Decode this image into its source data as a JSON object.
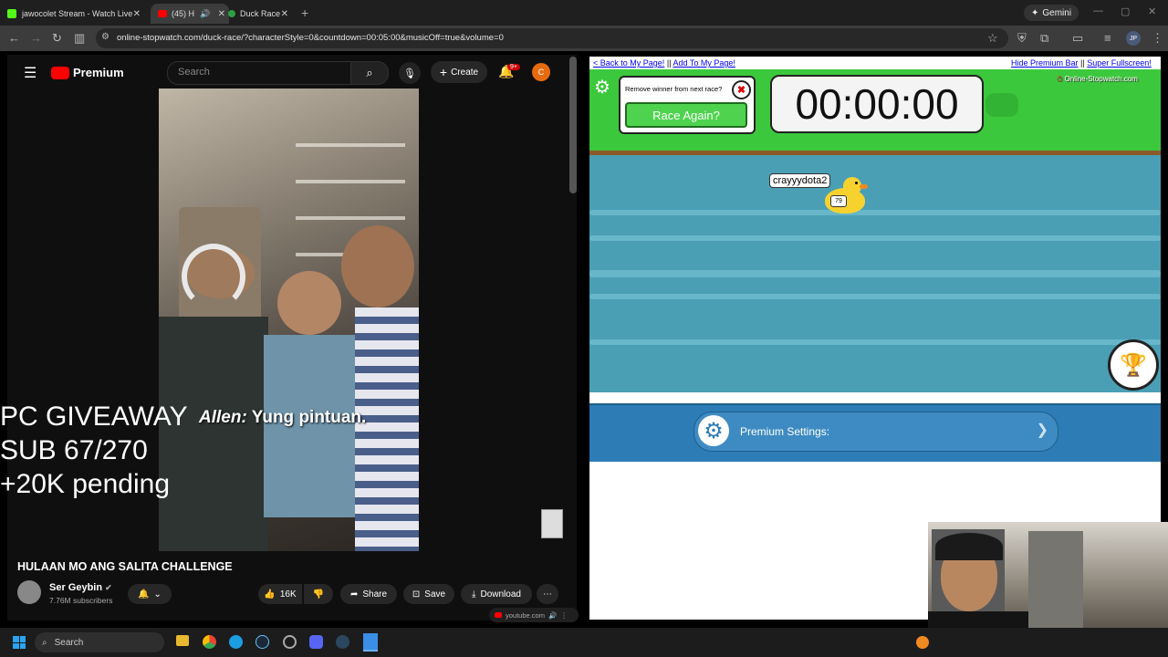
{
  "browser": {
    "tabs": [
      {
        "label": "jawocolet Stream - Watch Live"
      },
      {
        "label": "(45) H"
      },
      {
        "label": "Duck Race"
      }
    ],
    "gemini_label": "Gemini",
    "url": "online-stopwatch.com/duck-race/?characterStyle=0&countdown=00:05:00&musicOff=true&volume=0",
    "profile": "JP"
  },
  "youtube": {
    "brand": "Premium",
    "search_placeholder": "Search",
    "create_label": "Create",
    "notifications_badge": "9+",
    "avatar_letter": "C",
    "overlay_lines": [
      "PC GIVEAWAY",
      "SUB 67/270",
      "+20K pending"
    ],
    "caption_speaker": "Allen:",
    "caption_text": "Yung pintuan.",
    "video_title": "HULAAN MO ANG SALITA CHALLENGE",
    "channel_name": "Ser Geybin",
    "subscribers": "7.76M subscribers",
    "likes": "16K",
    "share_label": "Share",
    "save_label": "Save",
    "download_label": "Download",
    "mini_source": "youtube.com"
  },
  "duck_race": {
    "back_link": "< Back to My Page!",
    "add_link": "Add To My Page!",
    "separator": "||",
    "hide_premium": "Hide Premium Bar",
    "super_fullscreen": "Super Fullscreen!",
    "remove_winner_label": "Remove winner from next race?",
    "race_again_label": "Race Again?",
    "timer": "00:00:00",
    "logo_text": "Online-Stopwatch.com",
    "duck_name": "crayyydota2",
    "duck_number": "79",
    "premium_settings_label": "Premium Settings:"
  },
  "taskbar": {
    "search_label": "Search"
  }
}
